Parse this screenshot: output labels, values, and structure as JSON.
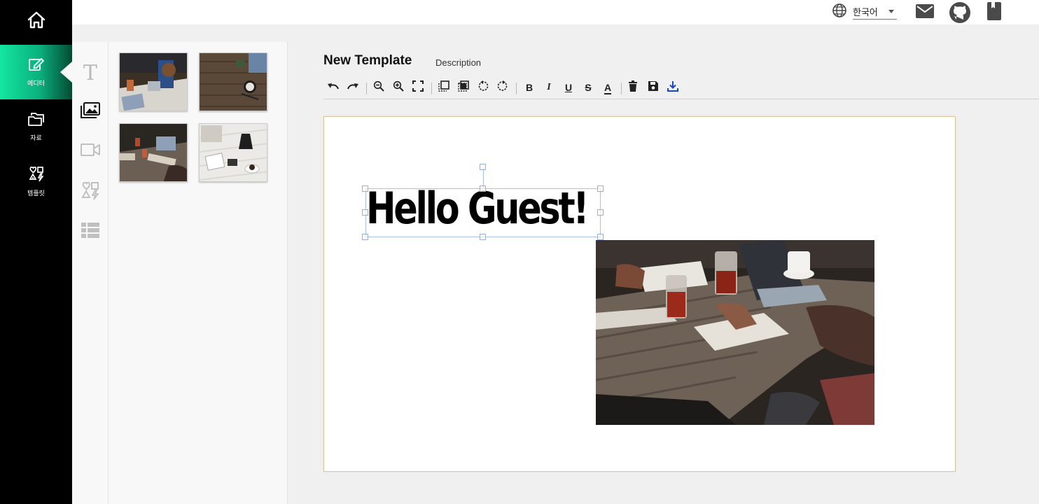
{
  "nav": {
    "home_icon": "home-icon",
    "items": [
      {
        "label": "에디터",
        "icon": "edit-icon",
        "active": true
      },
      {
        "label": "자료",
        "icon": "folder-icon",
        "active": false
      },
      {
        "label": "템플릿",
        "icon": "template-icon",
        "active": false
      }
    ]
  },
  "topbar": {
    "language_icon": "globe-icon",
    "language": "한국어",
    "icons": [
      "mail-icon",
      "github-icon",
      "book-icon"
    ]
  },
  "tools": [
    "text-tool-icon",
    "image-tool-icon",
    "video-tool-icon",
    "shapes-tool-icon",
    "table-tool-icon"
  ],
  "gallery": {
    "images": [
      "workspace-laptops-image",
      "wooden-desk-image",
      "team-meeting-image",
      "coffee-notebook-image"
    ]
  },
  "editor": {
    "title": "New Template",
    "description": "Description",
    "toolbar": [
      "undo",
      "redo",
      "zoom-out",
      "zoom-in",
      "fit-screen",
      "bring-front",
      "send-back",
      "rotate-left",
      "rotate-right",
      "bold",
      "italic",
      "underline",
      "strikethrough",
      "text-color",
      "delete",
      "save",
      "download"
    ],
    "bold_label": "B",
    "italic_label": "I",
    "underline_label": "U",
    "strike_label": "S",
    "color_label": "A",
    "canvas_text": "Hello Guest!"
  },
  "colors": {
    "accent": "#14e6a0",
    "nav_bg": "#000000",
    "download_icon": "#1846c8"
  }
}
